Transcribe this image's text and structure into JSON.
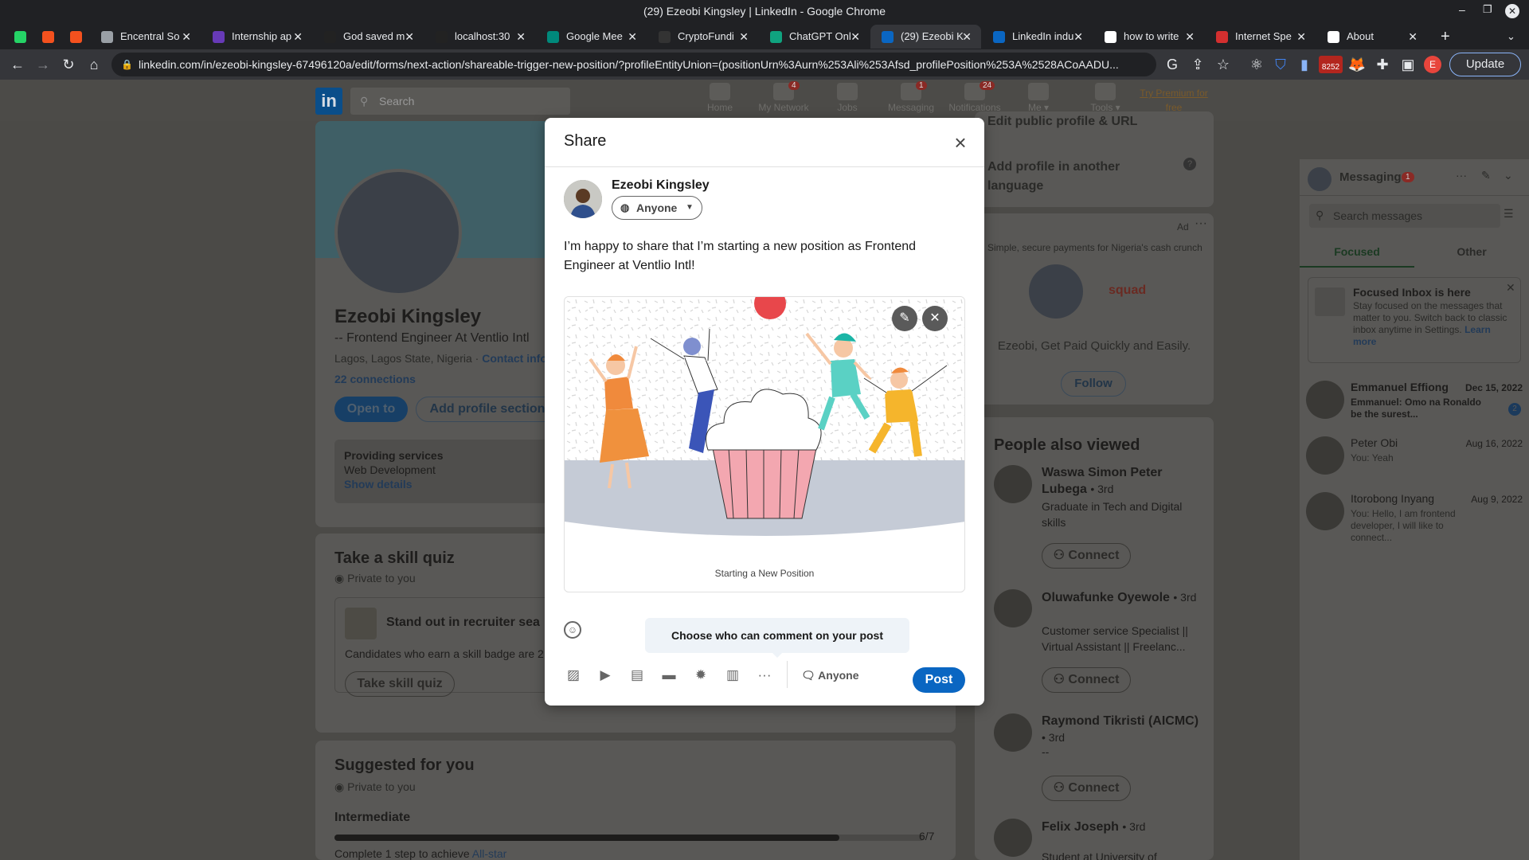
{
  "window": {
    "title": "(29) Ezeobi Kingsley | LinkedIn - Google Chrome"
  },
  "tabs": [
    {
      "label": "",
      "color": "#25d366"
    },
    {
      "label": "",
      "color": "#f4511e"
    },
    {
      "label": "",
      "color": "#f4511e"
    },
    {
      "label": "Encentral So",
      "color": "#9aa0a6"
    },
    {
      "label": "Internship ap",
      "color": "#673ab7"
    },
    {
      "label": "God saved m",
      "color": "#222"
    },
    {
      "label": "localhost:30",
      "color": "#222"
    },
    {
      "label": "Google Mee",
      "color": "#00897b"
    },
    {
      "label": "CryptoFundi",
      "color": "#333"
    },
    {
      "label": "ChatGPT Onl",
      "color": "#10a37f"
    },
    {
      "label": "(29) Ezeobi K",
      "color": "#0a66c2"
    },
    {
      "label": "LinkedIn indu",
      "color": "#0a66c2"
    },
    {
      "label": "how to write",
      "color": "#ffffff"
    },
    {
      "label": "Internet Spe",
      "color": "#d32f2f"
    },
    {
      "label": "About",
      "color": "#ffffff"
    }
  ],
  "browser": {
    "url": "linkedin.com/in/ezeobi-kingsley-67496120a/edit/forms/next-action/shareable-trigger-new-position/?profileEntityUnion=(positionUrn%3Aurn%253Ali%253Afsd_profilePosition%253A%2528ACoAADU...",
    "update_label": "Update",
    "ext_badge": "8252",
    "profile_initial": "E"
  },
  "linkedin_nav": {
    "search_placeholder": "Search",
    "items": [
      {
        "label": "Home",
        "badge": ""
      },
      {
        "label": "My Network",
        "badge": "4"
      },
      {
        "label": "Jobs",
        "badge": ""
      },
      {
        "label": "Messaging",
        "badge": "1"
      },
      {
        "label": "Notifications",
        "badge": "24"
      },
      {
        "label": "Me ▾",
        "badge": ""
      },
      {
        "label": "Tools ▾",
        "badge": ""
      }
    ],
    "premium": "Try Premium for free"
  },
  "profile": {
    "name": "Ezeobi Kingsley",
    "headline": "-- Frontend Engineer At Ventlio Intl",
    "location": "Lagos, Lagos State, Nigeria",
    "contact": "Contact info",
    "connections": "22 connections",
    "open_to": "Open to",
    "add_section": "Add profile section",
    "services_title": "Providing services",
    "services_value": "Web Development",
    "show_details": "Show details",
    "quiz_title": "Take a skill quiz",
    "private": "Private to you",
    "quiz_headline": "Stand out in recruiter sea",
    "quiz_text": "Candidates who earn a skill badge are 2",
    "quiz_btn": "Take skill quiz",
    "suggested_title": "Suggested for you",
    "level": "Intermediate",
    "progress_label": "6/7",
    "progress_value": 0.857,
    "allstar_prefix": "Complete 1 step to achieve ",
    "allstar_link": "All-star"
  },
  "right_rail": {
    "edit_public": "Edit public profile & URL",
    "add_language": "Add profile in another language",
    "ad_label": "Ad",
    "ad_tagline": "Simple, secure payments for Nigeria's cash crunch",
    "ad_brand": "squad",
    "ad_text": "Ezeobi, Get Paid Quickly and Easily.",
    "ad_follow": "Follow",
    "pav_title": "People also viewed",
    "people": [
      {
        "name": "Waswa Simon Peter Lubega",
        "degree": "• 3rd",
        "desc": "Graduate in Tech and Digital skills",
        "btn": "Connect"
      },
      {
        "name": "Oluwafunke Oyewole",
        "degree": "• 3rd",
        "desc": "Customer service Specialist || Virtual Assistant || Freelanc...",
        "btn": "Connect"
      },
      {
        "name": "Raymond Tikristi (AICMC)",
        "degree": "• 3rd",
        "desc": "--",
        "btn": "Connect"
      },
      {
        "name": "Felix Joseph",
        "degree": "• 3rd",
        "desc": "Student at University of",
        "btn": ""
      }
    ]
  },
  "messaging": {
    "title": "Messaging",
    "badge": "1",
    "search_placeholder": "Search messages",
    "tabs": [
      "Focused",
      "Other"
    ],
    "focused_title": "Focused Inbox is here",
    "focused_text": "Stay focused on the messages that matter to you. Switch back to classic inbox anytime in Settings.",
    "learn_more": "Learn more",
    "threads": [
      {
        "name": "Emmanuel Effiong",
        "date": "Dec 15, 2022",
        "preview": "Emmanuel: Omo na Ronaldo be the surest...",
        "unread": "2"
      },
      {
        "name": "Peter Obi",
        "date": "Aug 16, 2022",
        "preview": "You: Yeah",
        "unread": ""
      },
      {
        "name": "Itorobong Inyang",
        "date": "Aug 9, 2022",
        "preview": "You: Hello, I am frontend developer, I will like to connect...",
        "unread": ""
      }
    ]
  },
  "modal": {
    "title": "Share",
    "author": "Ezeobi Kingsley",
    "visibility": "Anyone",
    "post_text": "I’m happy to share that I’m starting a new position as Frontend Engineer at Ventlio Intl!",
    "media_caption": "Starting a New Position",
    "tooltip": "Choose who can comment on your post",
    "comment_control": "Anyone",
    "post_label": "Post"
  }
}
